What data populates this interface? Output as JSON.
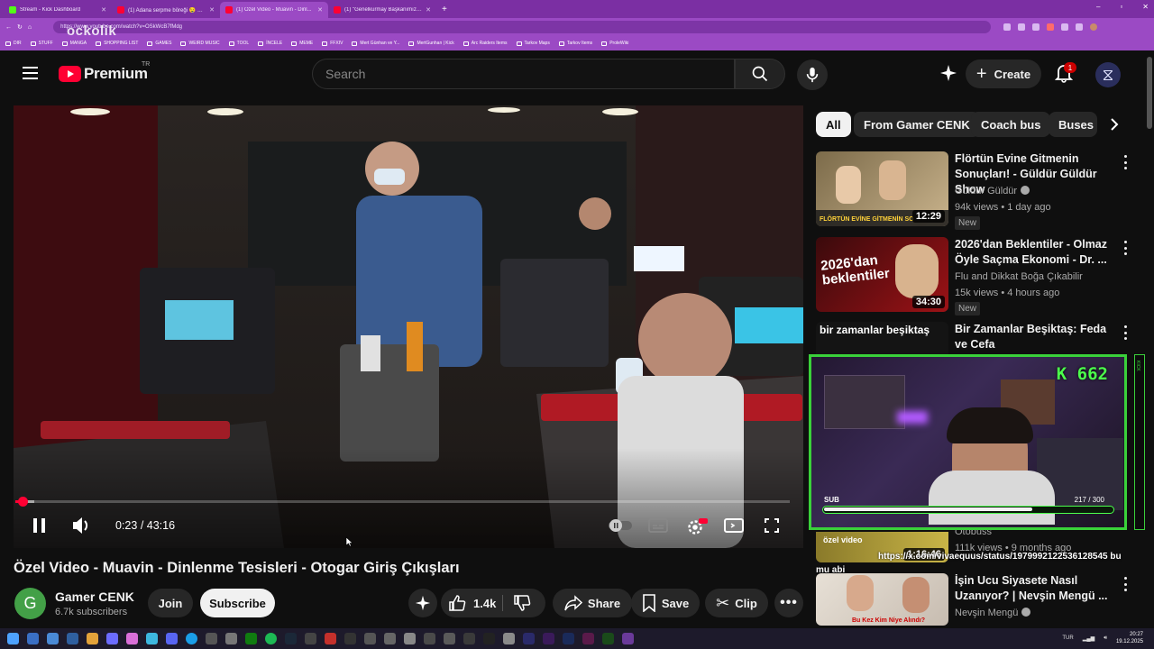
{
  "browser": {
    "tabs": [
      {
        "title": "Stream - Kick Dashboard",
        "color": "#53fc18"
      },
      {
        "title": "(1) Adana serpme böreği 🤤 #bö...",
        "color": "#ff0033"
      },
      {
        "title": "(1) Özel Video - Muavin - Dinl...",
        "color": "#ff0033"
      },
      {
        "title": "(1) \"Genelkurmay Başkanımız sıı...",
        "color": "#ff0033"
      }
    ],
    "new_tab": "+",
    "url": "https://www.youtube.com/watch?v=OSkWcB7fMdg",
    "bookmarks": [
      "DIR",
      "STUFF",
      "MANGA",
      "SHOPPING LIST",
      "GAMES",
      "WEIRD MUSIC",
      "TOOL",
      "İNCELE",
      "MEME",
      "FFXIV",
      "Mert Günhan ve Y...",
      "MertGunhan | Kick",
      "Arc Raiders Items",
      "Tarkov Maps",
      "Tarkov Items",
      "ProleWiki"
    ],
    "window_controls": [
      "–",
      "▫",
      "✕"
    ]
  },
  "watermark": "ockolik",
  "header": {
    "logo_text": "Premium",
    "country": "TR",
    "search_placeholder": "Search",
    "create_label": "Create",
    "notification_count": "1"
  },
  "player": {
    "current_time": "0:23",
    "duration": "43:16",
    "time_separator": " / ",
    "played_fraction": 0.009,
    "buffered_fraction": 0.025
  },
  "video": {
    "title": "Özel Video - Muavin - Dinlenme Tesisleri - Otogar Giriş Çıkışları",
    "channel": "Gamer CENK",
    "channel_initial": "G",
    "subscribers": "6.7k subscribers",
    "join_label": "Join",
    "subscribe_label": "Subscribe",
    "likes": "1.4k",
    "share_label": "Share",
    "save_label": "Save",
    "clip_label": "Clip"
  },
  "chips": [
    "All",
    "From Gamer CENK",
    "Coach bus",
    "Buses"
  ],
  "recommendations": [
    {
      "title": "Flörtün Evine Gitmenin Sonuçları! - Güldür Güldür Show",
      "channel": "Güldür Güldür",
      "verified": true,
      "meta": "94k views • 1 day ago",
      "badge": "New",
      "duration": "12:29",
      "thumb_text": "FLÖRTÜN EVİNE GİTMENİN SO"
    },
    {
      "title": "2026'dan Beklentiler - Olmaz Öyle Saçma Ekonomi - Dr. ...",
      "channel": "Flu and Dikkat Boğa Çıkabilir",
      "verified": false,
      "meta": "15k views • 4 hours ago",
      "badge": "New",
      "duration": "34:30",
      "thumb_text": "2026'dan beklentiler"
    },
    {
      "title": "Bir Zamanlar Beşiktaş: Feda ve Cefa",
      "channel": "",
      "verified": false,
      "meta": "",
      "badge": "",
      "duration": "",
      "thumb_text": "bir zamanlar beşiktaş"
    },
    {
      "title": "",
      "channel": "Otobüss",
      "verified": false,
      "meta": "111k views • 9 months ago",
      "badge": "",
      "duration": "1:16:46",
      "thumb_text": "özel video"
    },
    {
      "title": "İşin Ucu Siyasete Nasıl Uzanıyor? | Nevşin Mengü ...",
      "channel": "Nevşin Mengü",
      "verified": true,
      "meta": "",
      "badge": "",
      "duration": "",
      "thumb_text": "Bu Kez Kim Niye Alındı?"
    }
  ],
  "stream_overlay": {
    "follower_count": "662",
    "sub_label": "SUB",
    "sub_goal": "217 / 300",
    "sub_progress": 0.723,
    "chat_line_1": "https://x.com/vivaequus/status/1979992122536128545 bu",
    "chat_line_2": "mu abi",
    "kick_label": "KICK"
  },
  "taskbar": {
    "language": "TUR",
    "time": "20:27",
    "date": "19.12.2025"
  }
}
